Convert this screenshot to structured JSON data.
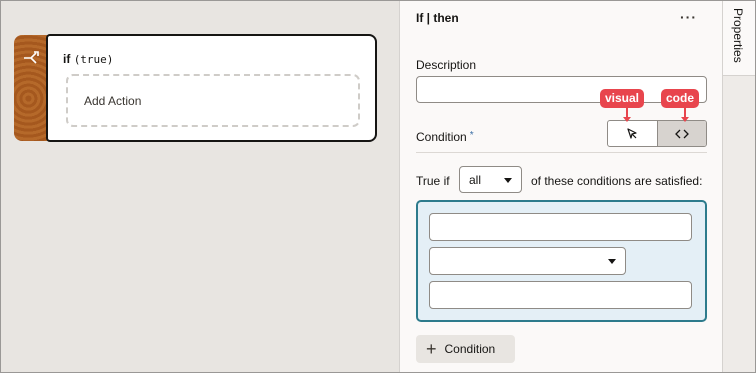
{
  "node": {
    "keyword": "if",
    "condition": "(true)",
    "add_action_label": "Add Action",
    "icon": "branch-icon"
  },
  "panel": {
    "title": "If | then",
    "more_icon": "ellipsis-icon",
    "description_label": "Description",
    "description_value": "",
    "condition_label": "Condition",
    "required_marker": "*",
    "mode_visual_icon": "pointer-icon",
    "mode_code_icon": "code-icon",
    "true_if_label": "True if",
    "match_selected": "all",
    "satisfied_label": "of these conditions are satisfied:",
    "condition_add_label": "Condition"
  },
  "callouts": {
    "visual": "visual",
    "code": "code"
  },
  "side_tab": {
    "label": "Properties"
  },
  "colors": {
    "callout": "#e8454d",
    "condition_box_border": "#2d7b8c",
    "condition_box_bg": "#e4eff6",
    "node_accent": "#a5581e"
  }
}
